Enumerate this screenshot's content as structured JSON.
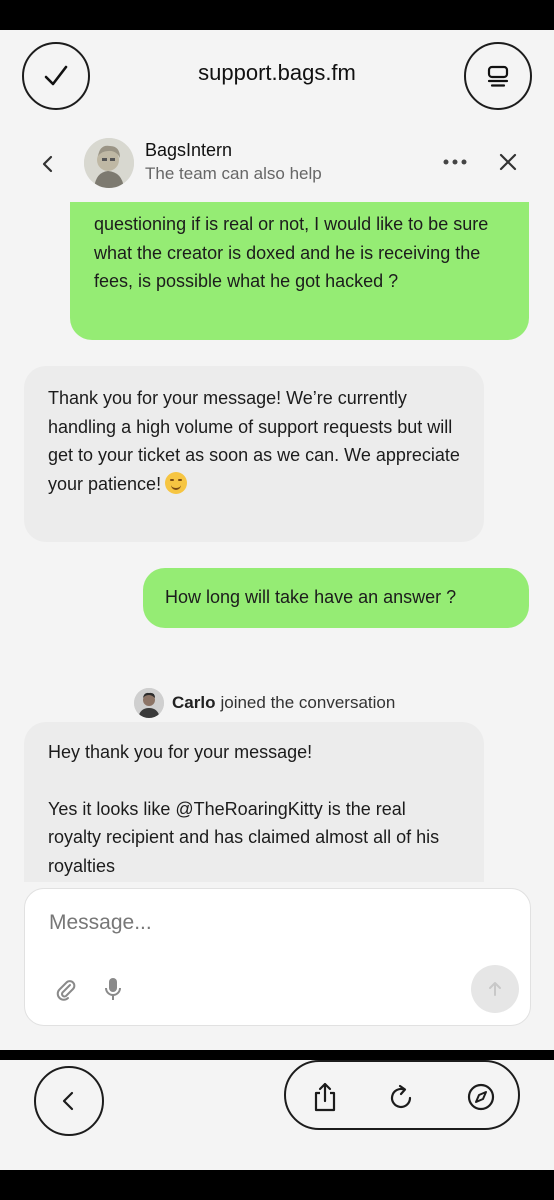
{
  "browser": {
    "url": "support.bags.fm",
    "icons": {
      "left": "checkmark-icon",
      "right": "tabs-icon"
    }
  },
  "chat_header": {
    "agent_name": "BagsIntern",
    "subtitle": "The team can also help",
    "icons": [
      "chevron-left-icon",
      "more-dots-icon",
      "close-icon"
    ]
  },
  "messages": [
    {
      "sender": "user",
      "text": "questioning if is real or not, I would like to be sure what the creator is doxed and he is receiving the fees, is possible what he got hacked ?"
    },
    {
      "sender": "agent",
      "text": "Thank you for your message! We’re currently handling a high volume of support requests but will get to your ticket as soon as we can. We appreciate your patience!",
      "emoji": "smiling-face"
    },
    {
      "sender": "user",
      "text": "How long will take have an answer ?"
    },
    {
      "sender": "agent",
      "line1": "Hey thank you for your message!",
      "line2": "Yes it looks like @TheRoaringKitty is the real royalty recipient and has claimed almost all of his royalties"
    }
  ],
  "join_event": {
    "name": "Carlo",
    "text": "joined the conversation"
  },
  "composer": {
    "placeholder": "Message...",
    "icons": [
      "paperclip-icon",
      "microphone-icon",
      "send-arrow-icon"
    ]
  },
  "toolbar": {
    "icons": [
      "back-icon",
      "share-icon",
      "reload-icon",
      "compass-icon"
    ]
  },
  "colors": {
    "user_bubble": "#95ec74",
    "agent_bubble": "#ececec",
    "background": "#f4f4f4"
  }
}
